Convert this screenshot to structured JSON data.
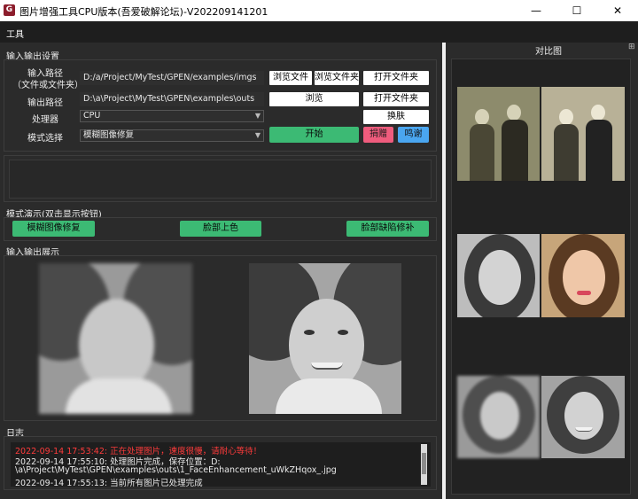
{
  "window": {
    "icon_letter": "G",
    "title": "图片增强工具CPU版本(吾爱破解论坛)-V202209141201",
    "minimize_glyph": "—",
    "maximize_glyph": "☐",
    "close_glyph": "✕"
  },
  "menu": {
    "tools": "工具"
  },
  "io_settings": {
    "title": "输入输出设置",
    "input_label_1": "输入路径",
    "input_label_2": "（文件或文件夹）",
    "input_path": "D:/a/Project/MyTest/GPEN/examples/imgs",
    "browse_file": "浏览文件",
    "browse_folder": "浏览文件夹",
    "open_folder": "打开文件夹",
    "output_label": "输出路径",
    "output_path": "D:\\a\\Project\\MyTest\\GPEN\\examples\\outs",
    "browse": "浏览",
    "open_folder_2": "打开文件夹",
    "processor_label": "处理器",
    "processor_value": "CPU",
    "skin_button": "换肤",
    "mode_label": "模式选择",
    "mode_value": "模糊图像修复",
    "start_button": "开始",
    "donate_button": "捐赠",
    "thanks_button": "鸣谢"
  },
  "mode_demo": {
    "title": "模式演示(双击显示按钮)",
    "blur_repair": "模糊图像修复",
    "face_colorize": "脸部上色",
    "face_inpaint": "脸部缺陷修补"
  },
  "display": {
    "title": "输入输出展示"
  },
  "log": {
    "title": "日志",
    "lines": [
      "2022-09-14 17:53:42: 正在处理图片，速度很慢，请耐心等待！",
      "2022-09-14 17:55:10: 处理图片完成，保存位置：D:",
      "\\a\\Project\\MyTest\\GPEN\\examples\\outs\\1_FaceEnhancement_uWkZHqox_.jpg",
      "2022-09-14 17:55:13: 当前所有图片已处理完成"
    ]
  },
  "compare": {
    "title": "对比图",
    "corner_glyph": "⊞"
  },
  "colors": {
    "green": "#3cba74",
    "pink": "#ef5c7d",
    "blue": "#4aa6f0",
    "log_red": "#ff3b3b"
  }
}
